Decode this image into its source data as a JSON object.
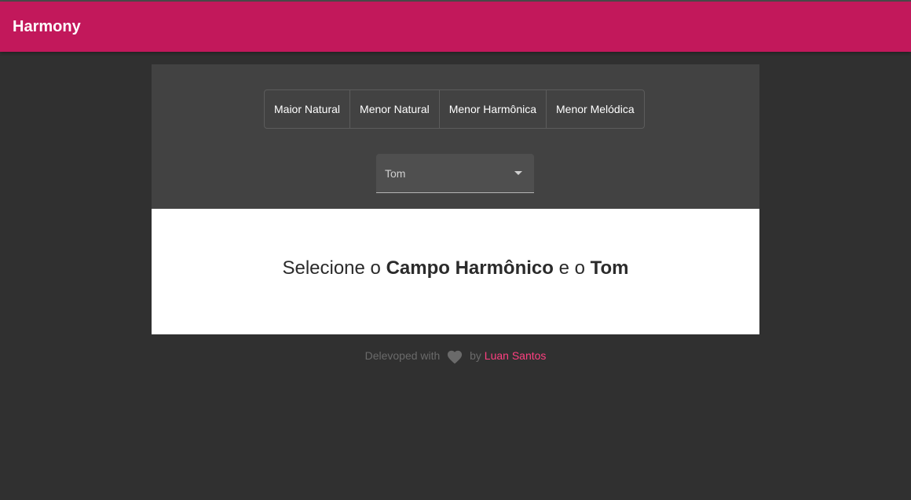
{
  "app": {
    "title": "Harmony"
  },
  "scales": [
    {
      "label": "Maior Natural"
    },
    {
      "label": "Menor Natural"
    },
    {
      "label": "Menor Harmônica"
    },
    {
      "label": "Menor Melódica"
    }
  ],
  "key_select": {
    "label": "Tom"
  },
  "message": {
    "prefix": "Selecione o ",
    "field": "Campo Harmônico",
    "middle": " e o ",
    "key": "Tom"
  },
  "footer": {
    "prefix": "Delevoped with",
    "by": "by",
    "author": "Luan Santos"
  },
  "colors": {
    "primary": "#c2185b",
    "accent": "#ff4081",
    "background": "#303030",
    "panel": "#424242"
  },
  "icons": {
    "heart": "heart-icon",
    "dropdown": "chevron-down-icon"
  }
}
